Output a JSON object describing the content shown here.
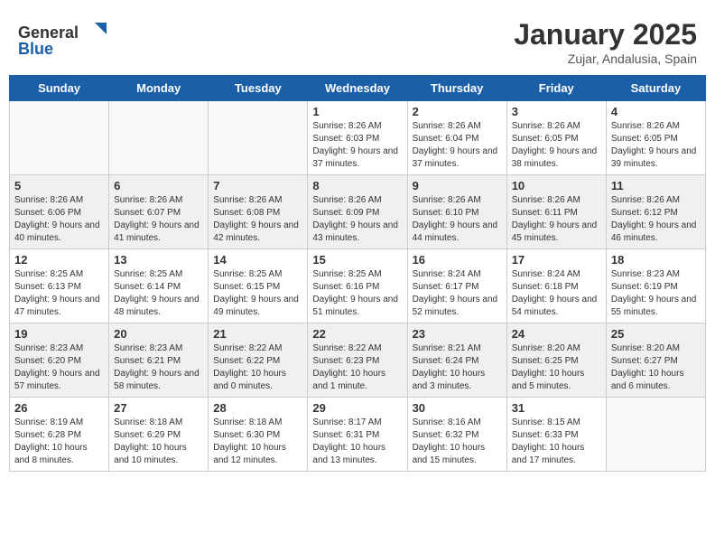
{
  "header": {
    "logo_general": "General",
    "logo_blue": "Blue",
    "title": "January 2025",
    "subtitle": "Zujar, Andalusia, Spain"
  },
  "days_of_week": [
    "Sunday",
    "Monday",
    "Tuesday",
    "Wednesday",
    "Thursday",
    "Friday",
    "Saturday"
  ],
  "weeks": [
    [
      {
        "day": "",
        "info": ""
      },
      {
        "day": "",
        "info": ""
      },
      {
        "day": "",
        "info": ""
      },
      {
        "day": "1",
        "info": "Sunrise: 8:26 AM\nSunset: 6:03 PM\nDaylight: 9 hours and 37 minutes."
      },
      {
        "day": "2",
        "info": "Sunrise: 8:26 AM\nSunset: 6:04 PM\nDaylight: 9 hours and 37 minutes."
      },
      {
        "day": "3",
        "info": "Sunrise: 8:26 AM\nSunset: 6:05 PM\nDaylight: 9 hours and 38 minutes."
      },
      {
        "day": "4",
        "info": "Sunrise: 8:26 AM\nSunset: 6:05 PM\nDaylight: 9 hours and 39 minutes."
      }
    ],
    [
      {
        "day": "5",
        "info": "Sunrise: 8:26 AM\nSunset: 6:06 PM\nDaylight: 9 hours and 40 minutes."
      },
      {
        "day": "6",
        "info": "Sunrise: 8:26 AM\nSunset: 6:07 PM\nDaylight: 9 hours and 41 minutes."
      },
      {
        "day": "7",
        "info": "Sunrise: 8:26 AM\nSunset: 6:08 PM\nDaylight: 9 hours and 42 minutes."
      },
      {
        "day": "8",
        "info": "Sunrise: 8:26 AM\nSunset: 6:09 PM\nDaylight: 9 hours and 43 minutes."
      },
      {
        "day": "9",
        "info": "Sunrise: 8:26 AM\nSunset: 6:10 PM\nDaylight: 9 hours and 44 minutes."
      },
      {
        "day": "10",
        "info": "Sunrise: 8:26 AM\nSunset: 6:11 PM\nDaylight: 9 hours and 45 minutes."
      },
      {
        "day": "11",
        "info": "Sunrise: 8:26 AM\nSunset: 6:12 PM\nDaylight: 9 hours and 46 minutes."
      }
    ],
    [
      {
        "day": "12",
        "info": "Sunrise: 8:25 AM\nSunset: 6:13 PM\nDaylight: 9 hours and 47 minutes."
      },
      {
        "day": "13",
        "info": "Sunrise: 8:25 AM\nSunset: 6:14 PM\nDaylight: 9 hours and 48 minutes."
      },
      {
        "day": "14",
        "info": "Sunrise: 8:25 AM\nSunset: 6:15 PM\nDaylight: 9 hours and 49 minutes."
      },
      {
        "day": "15",
        "info": "Sunrise: 8:25 AM\nSunset: 6:16 PM\nDaylight: 9 hours and 51 minutes."
      },
      {
        "day": "16",
        "info": "Sunrise: 8:24 AM\nSunset: 6:17 PM\nDaylight: 9 hours and 52 minutes."
      },
      {
        "day": "17",
        "info": "Sunrise: 8:24 AM\nSunset: 6:18 PM\nDaylight: 9 hours and 54 minutes."
      },
      {
        "day": "18",
        "info": "Sunrise: 8:23 AM\nSunset: 6:19 PM\nDaylight: 9 hours and 55 minutes."
      }
    ],
    [
      {
        "day": "19",
        "info": "Sunrise: 8:23 AM\nSunset: 6:20 PM\nDaylight: 9 hours and 57 minutes."
      },
      {
        "day": "20",
        "info": "Sunrise: 8:23 AM\nSunset: 6:21 PM\nDaylight: 9 hours and 58 minutes."
      },
      {
        "day": "21",
        "info": "Sunrise: 8:22 AM\nSunset: 6:22 PM\nDaylight: 10 hours and 0 minutes."
      },
      {
        "day": "22",
        "info": "Sunrise: 8:22 AM\nSunset: 6:23 PM\nDaylight: 10 hours and 1 minute."
      },
      {
        "day": "23",
        "info": "Sunrise: 8:21 AM\nSunset: 6:24 PM\nDaylight: 10 hours and 3 minutes."
      },
      {
        "day": "24",
        "info": "Sunrise: 8:20 AM\nSunset: 6:25 PM\nDaylight: 10 hours and 5 minutes."
      },
      {
        "day": "25",
        "info": "Sunrise: 8:20 AM\nSunset: 6:27 PM\nDaylight: 10 hours and 6 minutes."
      }
    ],
    [
      {
        "day": "26",
        "info": "Sunrise: 8:19 AM\nSunset: 6:28 PM\nDaylight: 10 hours and 8 minutes."
      },
      {
        "day": "27",
        "info": "Sunrise: 8:18 AM\nSunset: 6:29 PM\nDaylight: 10 hours and 10 minutes."
      },
      {
        "day": "28",
        "info": "Sunrise: 8:18 AM\nSunset: 6:30 PM\nDaylight: 10 hours and 12 minutes."
      },
      {
        "day": "29",
        "info": "Sunrise: 8:17 AM\nSunset: 6:31 PM\nDaylight: 10 hours and 13 minutes."
      },
      {
        "day": "30",
        "info": "Sunrise: 8:16 AM\nSunset: 6:32 PM\nDaylight: 10 hours and 15 minutes."
      },
      {
        "day": "31",
        "info": "Sunrise: 8:15 AM\nSunset: 6:33 PM\nDaylight: 10 hours and 17 minutes."
      },
      {
        "day": "",
        "info": ""
      }
    ]
  ]
}
